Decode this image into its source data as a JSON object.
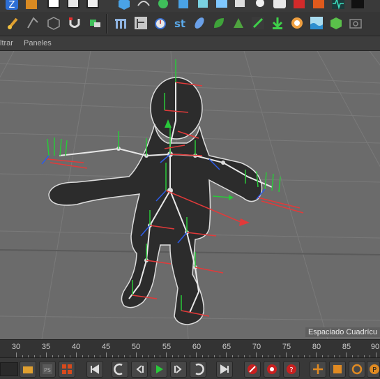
{
  "menubar": {
    "items": [
      "ltrar",
      "Paneles"
    ]
  },
  "viewport": {
    "grid_label": "Espaciado Cuadrícu"
  },
  "timeline": {
    "ticks": [
      "30",
      "35",
      "40",
      "45",
      "50",
      "55",
      "60",
      "65",
      "70",
      "75",
      "80",
      "85",
      "90"
    ]
  },
  "transport": {
    "frame_value": "",
    "buttons": [
      "go-to-start",
      "previous-key",
      "previous-frame",
      "play",
      "next-frame",
      "next-key",
      "go-to-end",
      "record",
      "autokey",
      "keyframe-selection",
      "move-tool",
      "scale-tool",
      "rotate-tool",
      "param-tool"
    ]
  },
  "colors": {
    "accent_green": "#29c93a",
    "accent_red": "#e23a3a",
    "accent_blue": "#2c5ce8",
    "viewport_bg": "#6b6b6b"
  }
}
